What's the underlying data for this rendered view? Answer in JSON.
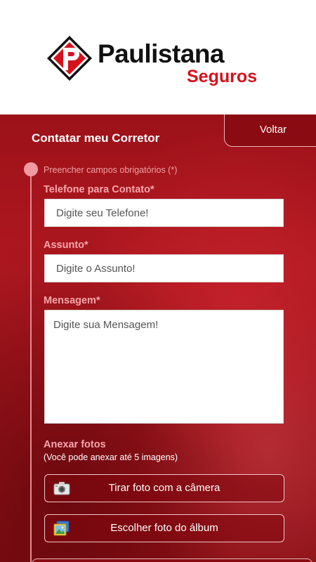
{
  "brand": {
    "name": "Paulistana",
    "subname": "Seguros",
    "accent": "#d6111d"
  },
  "header": {
    "title": "Contatar meu Corretor",
    "back_label": "Voltar"
  },
  "form": {
    "required_note": "Preencher campos obrigatórios (*)",
    "phone": {
      "label": "Telefone para Contato",
      "placeholder": "Digite seu Telefone!"
    },
    "subject": {
      "label": "Assunto",
      "placeholder": "Digite o Assunto!"
    },
    "message": {
      "label": "Mensagem",
      "placeholder": "Digite sua Mensagem!"
    },
    "required_mark": "*"
  },
  "attach": {
    "title": "Anexar fotos",
    "subtitle": "(Você pode anexar até 5 imagens)",
    "camera_label": "Tirar foto com a câmera",
    "camera_icon": "camera-icon",
    "album_label": "Escolher foto do álbum",
    "album_icon": "photo-album-icon"
  },
  "colors": {
    "background": "#8e0f14",
    "label_pink": "#f6a6ab"
  }
}
